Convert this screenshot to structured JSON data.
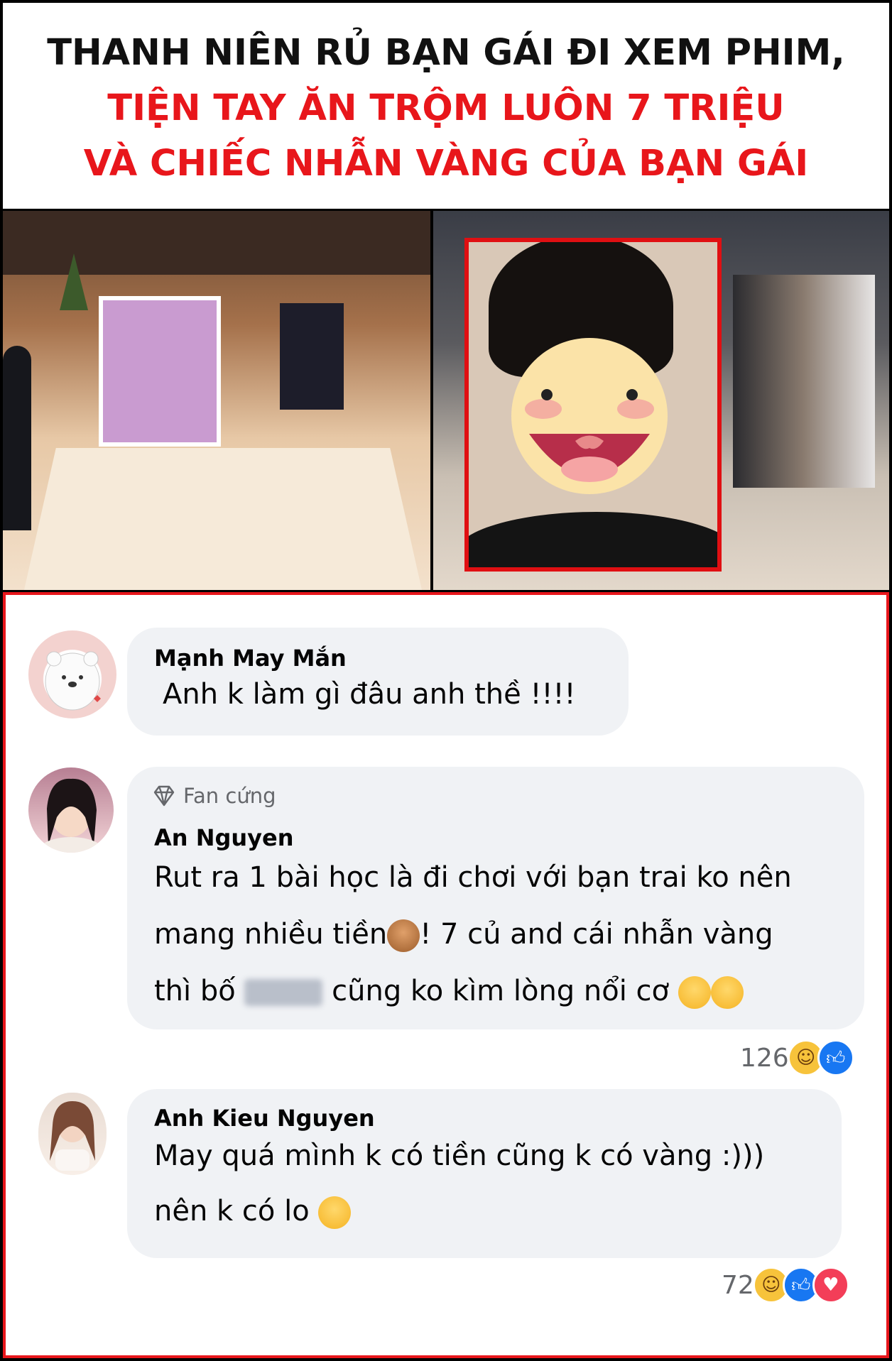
{
  "headline": {
    "line1": "THANH NIÊN RỦ BẠN GÁI ĐI XEM PHIM,",
    "line2": "TIỆN TAY ĂN TRỘM LUÔN 7 TRIỆU",
    "line3": "VÀ CHIẾC NHẪN VÀNG CỦA BẠN GÁI",
    "color_main": "#111111",
    "color_accent": "#e8161b"
  },
  "comments": [
    {
      "author": "Mạnh May Mắn",
      "lines": [
        "Anh k làm gì đâu anh thề !!!!"
      ]
    },
    {
      "badge": "Fan cứng",
      "author": "An Nguyen",
      "lines": [
        "Rut ra 1 bài học là đi chơi với bạn trai ko nên",
        "mang nhiều tiền",
        "! 7 củ and cái nhẫn vàng",
        "thì bố",
        "cũng ko kìm lòng nổi  cơ"
      ],
      "reaction_count": "126",
      "reactions": [
        "haha",
        "like"
      ]
    },
    {
      "author": "Anh Kieu Nguyen",
      "lines": [
        "May quá mình k có tiền cũng k có vàng :)))",
        "nên k có lo"
      ],
      "reaction_count": "72",
      "reactions": [
        "haha",
        "like",
        "love"
      ]
    }
  ]
}
